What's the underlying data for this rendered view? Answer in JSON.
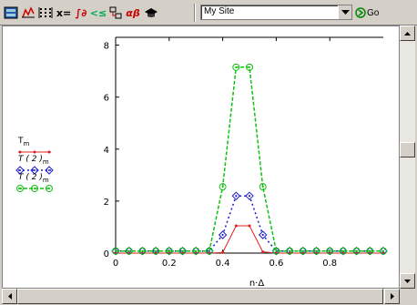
{
  "toolbar": {
    "buttons": [
      {
        "icon": "math-palette-icon"
      },
      {
        "icon": "graph-icon"
      },
      {
        "icon": "matrix-icon"
      },
      {
        "icon": "evaluation-icon",
        "label": "x="
      },
      {
        "icon": "calculus-icon",
        "label": "∫∂"
      },
      {
        "icon": "boolean-icon",
        "label": "<≤"
      },
      {
        "icon": "programming-icon"
      },
      {
        "icon": "greek-icon",
        "label": "αβ"
      },
      {
        "icon": "symbolic-icon"
      }
    ],
    "address": {
      "value": "My Site"
    },
    "go_label": "Go"
  },
  "colors": {
    "series1": "#e02020",
    "series2": "#1a1acc",
    "series3": "#10c010"
  },
  "legend": [
    {
      "label": "T",
      "sub": "m"
    },
    {
      "label": "T ( 2 )",
      "sub": "m"
    },
    {
      "label": "T ( 2 )",
      "sub": "m"
    }
  ],
  "chart_data": {
    "type": "line",
    "xlabel": "n·Δ",
    "xlim": [
      0,
      1
    ],
    "ylim": [
      0,
      8.3
    ],
    "xticks": [
      "0",
      "0.2",
      "0.4",
      "0.6",
      "0.8"
    ],
    "yticks": [
      "0",
      "2",
      "4",
      "6",
      "8"
    ],
    "x": [
      0,
      0.05,
      0.1,
      0.15,
      0.2,
      0.25,
      0.3,
      0.35,
      0.4,
      0.45,
      0.5,
      0.55,
      0.6,
      0.65,
      0.7,
      0.75,
      0.8,
      0.85,
      0.9,
      0.95,
      1.0
    ],
    "series": [
      {
        "values": [
          0,
          0,
          0,
          0,
          0,
          0,
          0,
          0,
          0.02,
          1.05,
          1.05,
          0.05,
          0,
          0,
          0,
          0,
          0,
          0,
          0,
          0,
          0
        ]
      },
      {
        "values": [
          0.08,
          0.08,
          0.08,
          0.08,
          0.08,
          0.08,
          0.08,
          0.08,
          0.7,
          2.2,
          2.2,
          0.7,
          0.08,
          0.08,
          0.08,
          0.08,
          0.08,
          0.08,
          0.08,
          0.08,
          0.08
        ]
      },
      {
        "values": [
          0.08,
          0.08,
          0.08,
          0.08,
          0.08,
          0.08,
          0.08,
          0.08,
          2.55,
          7.15,
          7.15,
          2.55,
          0.08,
          0.08,
          0.08,
          0.08,
          0.08,
          0.08,
          0.08,
          0.08,
          0.08
        ]
      }
    ]
  }
}
